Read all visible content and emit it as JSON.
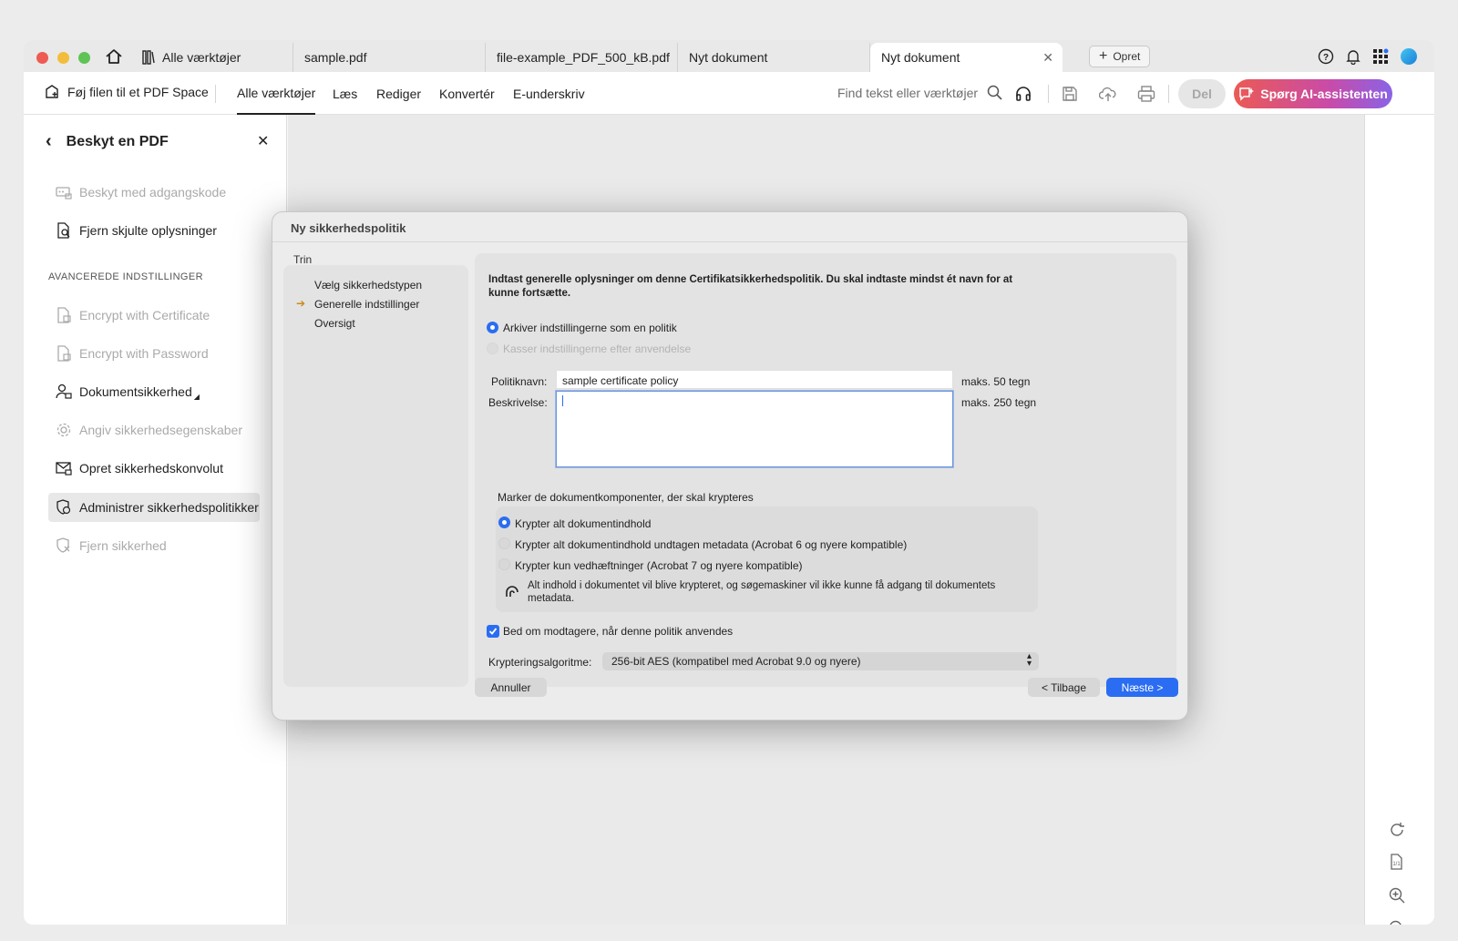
{
  "tabs": [
    {
      "label": "Alle værktøjer",
      "icon": "tools-icon"
    },
    {
      "label": "sample.pdf"
    },
    {
      "label": "file-example_PDF_500_kB.pdf"
    },
    {
      "label": "Nyt dokument"
    },
    {
      "label": "Nyt dokument",
      "active": true
    }
  ],
  "new_tab_label": "Opret",
  "toolbar": {
    "add_to_space": "Føj filen til et PDF Space",
    "menus": [
      "Alle værktøjer",
      "Læs",
      "Rediger",
      "Konvertér",
      "E-underskriv"
    ],
    "search_placeholder": "Find tekst eller værktøjer",
    "share_label": "Del",
    "ai_label": "Spørg AI-assistenten"
  },
  "sidebar": {
    "title": "Beskyt en PDF",
    "items_top": [
      {
        "label": "Beskyt med adgangskode",
        "disabled": true
      },
      {
        "label": "Fjern skjulte oplysninger",
        "disabled": false
      }
    ],
    "section_label": "AVANCEREDE INDSTILLINGER",
    "items_adv": [
      {
        "label": "Encrypt with Certificate",
        "disabled": true
      },
      {
        "label": "Encrypt with Password",
        "disabled": true
      },
      {
        "label": "Dokumentsikkerhed",
        "disabled": false
      },
      {
        "label": "Angiv sikkerhedsegenskaber",
        "disabled": true
      },
      {
        "label": "Opret sikkerhedskonvolut",
        "disabled": false
      },
      {
        "label": "Administrer sikkerhedspolitikker",
        "disabled": false,
        "selected": true
      },
      {
        "label": "Fjern sikkerhed",
        "disabled": true
      }
    ]
  },
  "dialog": {
    "title": "Ny sikkerhedspolitik",
    "steps_label": "Trin",
    "steps": [
      "Vælg sikkerhedstypen",
      "Generelle indstillinger",
      "Oversigt"
    ],
    "current_step": "Generelle indstillinger",
    "intro": "Indtast generelle oplysninger om denne Certifikatsikkerhedspolitik. Du skal indtaste mindst ét navn for at kunne fortsætte.",
    "save_option": "Arkiver indstillingerne som en politik",
    "discard_option": "Kasser indstillingerne efter anvendelse",
    "policy_name_label": "Politiknavn:",
    "policy_name_value": "sample certificate policy",
    "policy_name_max": "maks. 50 tegn",
    "description_label": "Beskrivelse:",
    "description_value": "",
    "description_max": "maks. 250 tegn",
    "components_label": "Marker de dokumentkomponenter, der skal krypteres",
    "components": [
      {
        "label": "Krypter alt dokumentindhold",
        "selected": true
      },
      {
        "label": "Krypter alt dokumentindhold undtagen metadata (Acrobat 6 og nyere kompatible)",
        "selected": false
      },
      {
        "label": "Krypter kun vedhæftninger (Acrobat 7 og nyere kompatible)",
        "selected": false
      }
    ],
    "components_note": "Alt indhold i dokumentet vil blive krypteret, og søgemaskiner vil ikke kunne få adgang til dokumentets metadata.",
    "ask_recipients": "Bed om modtagere, når denne politik anvendes",
    "ask_recipients_checked": true,
    "algorithm_label": "Krypteringsalgoritme:",
    "algorithm_value": "256-bit AES (kompatibel med Acrobat 9.0 og nyere)",
    "cancel": "Annuller",
    "back": "< Tilbage",
    "next": "Næste >"
  },
  "colors": {
    "accent": "#2a6df2",
    "ai_gradient_start": "#eb5a55",
    "ai_gradient_end": "#8a63e6",
    "step_arrow": "#c98c1c"
  }
}
